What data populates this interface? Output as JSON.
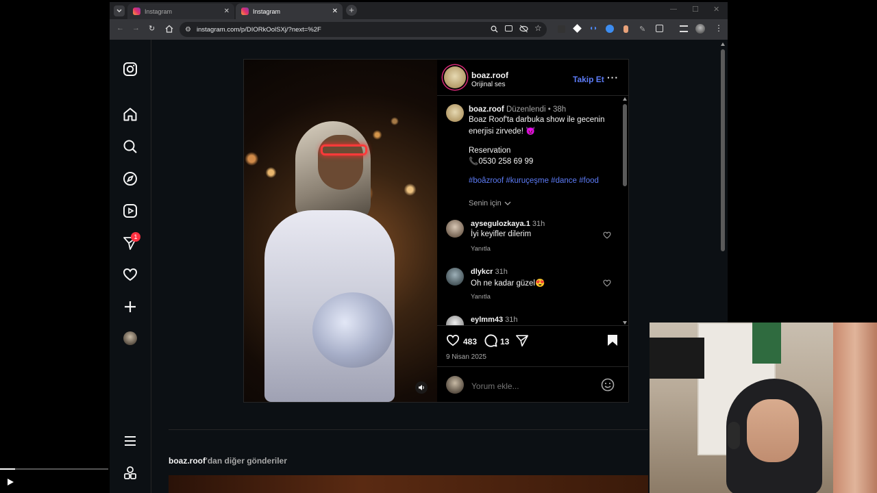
{
  "browser": {
    "tabs": [
      {
        "title": "Instagram",
        "active": false
      },
      {
        "title": "Instagram",
        "active": true
      }
    ],
    "url": "instagram.com/p/DIORkOolSXj/?next=%2F"
  },
  "sidebar": {
    "notification_badge": "1"
  },
  "post": {
    "author": "boaz.roof",
    "audio": "Orijinal ses",
    "follow_label": "Takip Et",
    "caption": {
      "username": "boaz.roof",
      "edited": "Düzenlendi",
      "separator": "•",
      "time": "38h",
      "line1": "Boaz Roof'ta darbuka show ile gecenin",
      "line2": "enerjisi zirvede! 😈",
      "reservation_label": "Reservation",
      "phone": "📞0530 258 69 99",
      "hashtags": "#boâzroof #kuruçeşme #dance #food",
      "translate_label": "Senin için"
    },
    "comments": [
      {
        "user": "aysegulozkaya.1",
        "time": "31h",
        "text": "İyi keyifler dilerim",
        "reply": "Yanıtla"
      },
      {
        "user": "dlykcr",
        "time": "31h",
        "text": "Oh ne kadar güzel😍",
        "reply": "Yanıtla"
      },
      {
        "user": "eylmm43",
        "time": "31h",
        "text": "",
        "reply": ""
      }
    ],
    "likes": "483",
    "comment_count": "13",
    "date": "9 Nisan 2025",
    "comment_placeholder": "Yorum ekle..."
  },
  "more_posts": {
    "username": "boaz.roof",
    "suffix": "'dan diğer gönderiler"
  },
  "colors": {
    "accent": "#5d7cf7",
    "badge": "#ff3040",
    "background": "#0c1014"
  }
}
